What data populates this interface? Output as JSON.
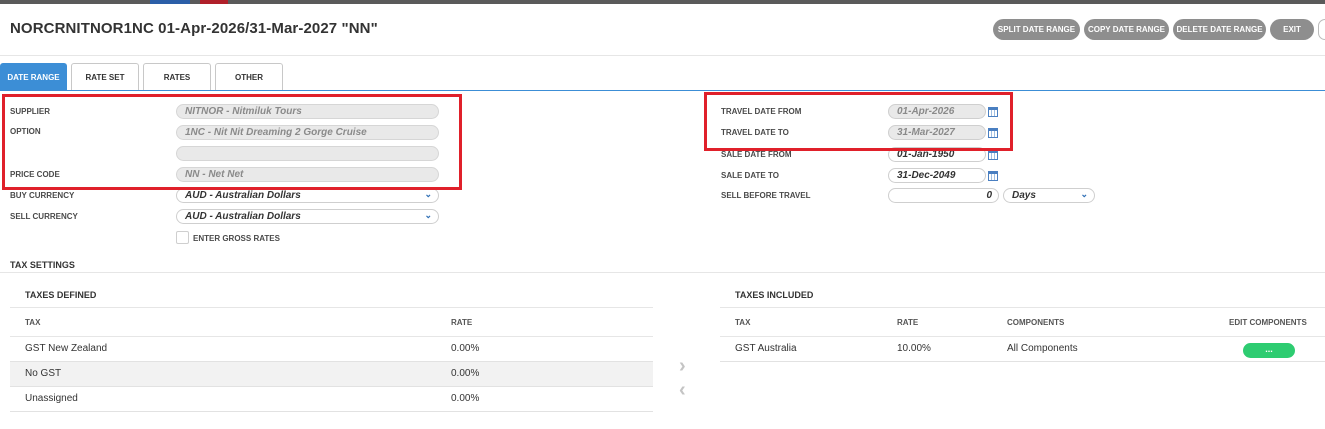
{
  "header": {
    "title": "NORCRNITNOR1NC 01-Apr-2026/31-Mar-2027 \"NN\"",
    "buttons": {
      "split": "SPLIT DATE RANGE",
      "copy": "COPY DATE RANGE",
      "delete": "DELETE DATE RANGE",
      "exit": "EXIT"
    }
  },
  "tabs": [
    "DATE RANGE",
    "RATE SET",
    "RATES",
    "OTHER"
  ],
  "form_left": {
    "supplier_label": "SUPPLIER",
    "supplier_value": "NITNOR - Nitmiluk Tours",
    "option_label": "OPTION",
    "option_value": "1NC - Nit Nit Dreaming 2 Gorge Cruise",
    "option_extra": "",
    "price_code_label": "PRICE CODE",
    "price_code_value": "NN - Net Net",
    "buy_currency_label": "BUY CURRENCY",
    "buy_currency_value": "AUD - Australian Dollars",
    "sell_currency_label": "SELL CURRENCY",
    "sell_currency_value": "AUD - Australian Dollars",
    "gross_rates_label": "ENTER GROSS RATES"
  },
  "form_right": {
    "travel_from_label": "TRAVEL DATE FROM",
    "travel_from_value": "01-Apr-2026",
    "travel_to_label": "TRAVEL DATE TO",
    "travel_to_value": "31-Mar-2027",
    "sale_from_label": "SALE DATE FROM",
    "sale_from_value": "01-Jan-1950",
    "sale_to_label": "SALE DATE TO",
    "sale_to_value": "31-Dec-2049",
    "sell_before_label": "SELL BEFORE TRAVEL",
    "sell_before_value": "0",
    "sell_before_unit": "Days"
  },
  "tax": {
    "section_title": "TAX SETTINGS",
    "defined": {
      "title": "TAXES DEFINED",
      "col_tax": "TAX",
      "col_rate": "RATE",
      "rows": [
        {
          "tax": "GST New Zealand",
          "rate": "0.00%"
        },
        {
          "tax": "No GST",
          "rate": "0.00%"
        },
        {
          "tax": "Unassigned",
          "rate": "0.00%"
        }
      ]
    },
    "included": {
      "title": "TAXES INCLUDED",
      "col_tax": "TAX",
      "col_rate": "RATE",
      "col_components": "COMPONENTS",
      "col_edit": "EDIT COMPONENTS",
      "rows": [
        {
          "tax": "GST Australia",
          "rate": "10.00%",
          "components": "All Components",
          "edit": "..."
        }
      ]
    }
  },
  "colors": {
    "accent": "#3c8ed6",
    "highlight": "#e0202a",
    "button_grey": "#8e8e8e",
    "edit_green": "#2ecc71"
  }
}
